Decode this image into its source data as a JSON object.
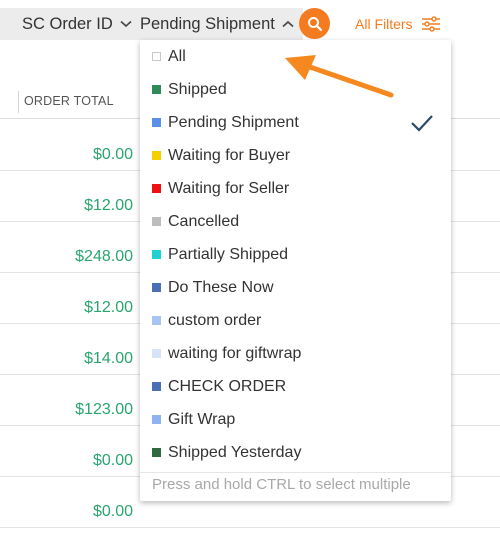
{
  "filter_bar": {
    "field_select_label": "SC Order ID",
    "status_select_label": "Pending Shipment",
    "all_filters_label": "All Filters",
    "accent_color": "#f47b20"
  },
  "table": {
    "column_header": "ORDER TOTAL",
    "amounts": [
      "$0.00",
      "$12.00",
      "$248.00",
      "$12.00",
      "$14.00",
      "$123.00",
      "$0.00",
      "$0.00"
    ],
    "amount_color": "#2aa56f"
  },
  "dropdown": {
    "options": [
      {
        "label": "All",
        "color": "#ffffff",
        "selected": false
      },
      {
        "label": "Shipped",
        "color": "#2e8b57",
        "selected": false
      },
      {
        "label": "Pending Shipment",
        "color": "#5b8fe8",
        "selected": true
      },
      {
        "label": "Waiting for Buyer",
        "color": "#f5d000",
        "selected": false
      },
      {
        "label": "Waiting for Seller",
        "color": "#ee1111",
        "selected": false
      },
      {
        "label": "Cancelled",
        "color": "#bdbdbd",
        "selected": false
      },
      {
        "label": "Partially Shipped",
        "color": "#1fd1d1",
        "selected": false
      },
      {
        "label": "Do These Now",
        "color": "#4a6fb5",
        "selected": false
      },
      {
        "label": "custom order",
        "color": "#a9c4f0",
        "selected": false
      },
      {
        "label": "waiting for giftwrap",
        "color": "#d7e4f7",
        "selected": false
      },
      {
        "label": "CHECK ORDER",
        "color": "#4a6fb5",
        "selected": false
      },
      {
        "label": "Gift Wrap",
        "color": "#8fb3f0",
        "selected": false
      },
      {
        "label": "Shipped Yesterday",
        "color": "#2d6a3e",
        "selected": false
      }
    ],
    "hint": "Press and hold CTRL to select multiple",
    "check_color": "#2c4a6b"
  },
  "annotation": {
    "arrow_color": "#f5891f"
  },
  "icons": {
    "field_chevron": "chevron-down-icon",
    "status_chevron": "chevron-up-icon",
    "search": "search-icon",
    "filters": "sliders-icon",
    "check": "checkmark-icon"
  }
}
